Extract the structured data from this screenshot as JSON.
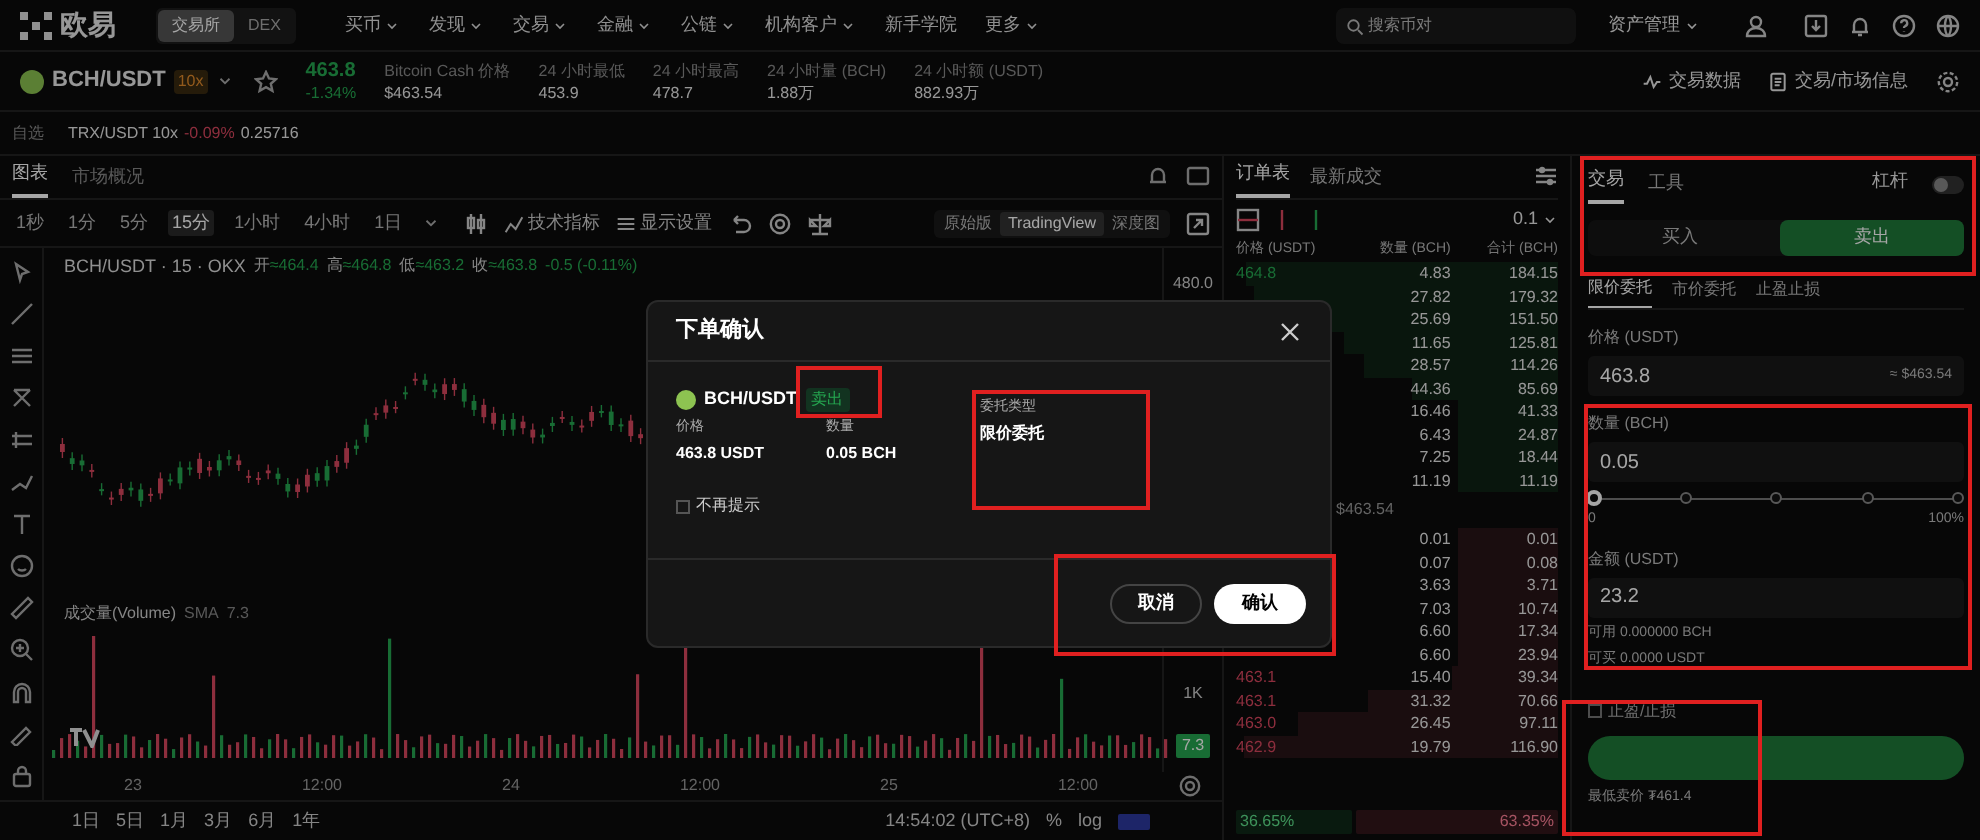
{
  "top_nav": {
    "logo": "欧易",
    "modes": [
      {
        "label": "交易所",
        "selected": true
      },
      {
        "label": "DEX",
        "selected": false
      }
    ],
    "menu": [
      {
        "label": "买币",
        "dropdown": true
      },
      {
        "label": "发现",
        "dropdown": true
      },
      {
        "label": "交易",
        "dropdown": true
      },
      {
        "label": "金融",
        "dropdown": true
      },
      {
        "label": "公链",
        "dropdown": true
      },
      {
        "label": "机构客户",
        "dropdown": true
      },
      {
        "label": "新手学院",
        "dropdown": false
      },
      {
        "label": "更多",
        "dropdown": true
      }
    ],
    "search": {
      "placeholder": "搜索币对"
    },
    "assets": "资产管理"
  },
  "ticker": {
    "pair": "BCH/USDT",
    "leverage": "10x",
    "price": "463.8",
    "change": "-1.34%",
    "stats": [
      {
        "label": "Bitcoin Cash 价格",
        "value": "$463.54"
      },
      {
        "label": "24 小时最低",
        "value": "453.9"
      },
      {
        "label": "24 小时最高",
        "value": "478.7"
      },
      {
        "label": "24 小时量 (BCH)",
        "value": "1.88万"
      },
      {
        "label": "24 小时额 (USDT)",
        "value": "882.93万"
      }
    ],
    "links": [
      "交易数据",
      "交易/市场信息"
    ]
  },
  "favorites": {
    "label": "自选",
    "items": [
      {
        "pair": "TRX/USDT 10x",
        "change": "-0.09%",
        "price": "0.25716"
      }
    ]
  },
  "chart_panel": {
    "tabs": [
      {
        "label": "图表",
        "selected": true
      },
      {
        "label": "市场概况",
        "selected": false
      }
    ],
    "intervals": [
      {
        "label": "1秒",
        "selected": false
      },
      {
        "label": "1分",
        "selected": false
      },
      {
        "label": "5分",
        "selected": false
      },
      {
        "label": "15分",
        "selected": true
      },
      {
        "label": "1小时",
        "selected": false
      },
      {
        "label": "4小时",
        "selected": false
      },
      {
        "label": "1日",
        "selected": false
      }
    ],
    "tools": [
      "技术指标",
      "显示设置"
    ],
    "views": [
      {
        "label": "原始版",
        "selected": false
      },
      {
        "label": "TradingView",
        "selected": true
      },
      {
        "label": "深度图",
        "selected": false
      }
    ],
    "legend": {
      "title": "BCH/USDT · 15 · OKX",
      "ohlc": [
        {
          "label": "开",
          "value": "≈464.4"
        },
        {
          "label": "高",
          "value": "≈464.8"
        },
        {
          "label": "低",
          "value": "≈463.2"
        },
        {
          "label": "收",
          "value": "≈463.8"
        }
      ],
      "change": "-0.5 (-0.11%)"
    },
    "price_axis": [
      "480.0"
    ],
    "volume_label": "成交量(Volume)",
    "volume_sma": "SMA",
    "volume_value": "7.3",
    "volume_axis": "1K",
    "volume_badge": "7.3",
    "time_axis": [
      "23",
      "12:00",
      "24",
      "12:00",
      "25",
      "12:00"
    ],
    "ranges": [
      "1日",
      "5日",
      "1月",
      "3月",
      "6月",
      "1年"
    ],
    "clock": "14:54:02 (UTC+8)",
    "scale_options": [
      "%",
      "log"
    ]
  },
  "order_book": {
    "tabs": [
      {
        "label": "订单表",
        "selected": true
      },
      {
        "label": "最新成交",
        "selected": false
      }
    ],
    "precision": "0.1",
    "columns": [
      "价格 (USDT)",
      "数量 (BCH)",
      "合计 (BCH)"
    ],
    "asks": [
      {
        "price": "464.8",
        "amount": "4.83",
        "total": "184.15"
      },
      {
        "amount": "27.82",
        "total": "179.32"
      },
      {
        "amount": "25.69",
        "total": "151.50"
      },
      {
        "amount": "11.65",
        "total": "125.81"
      },
      {
        "amount": "28.57",
        "total": "114.26"
      },
      {
        "amount": "44.36",
        "total": "85.69"
      },
      {
        "amount": "16.46",
        "total": "41.33"
      },
      {
        "amount": "6.43",
        "total": "24.87"
      },
      {
        "amount": "7.25",
        "total": "18.44"
      },
      {
        "amount": "11.19",
        "total": "11.19"
      }
    ],
    "mid_reference": "$463.54",
    "bids": [
      {
        "amount": "0.01",
        "total": "0.01"
      },
      {
        "amount": "0.07",
        "total": "0.08"
      },
      {
        "amount": "3.63",
        "total": "3.71"
      },
      {
        "amount": "7.03",
        "total": "10.74"
      },
      {
        "amount": "6.60",
        "total": "17.34"
      },
      {
        "amount": "6.60",
        "total": "23.94"
      },
      {
        "price": "463.1",
        "amount": "15.40",
        "total": "39.34"
      },
      {
        "price": "463.1",
        "amount": "31.32",
        "total": "70.66"
      },
      {
        "price": "463.0",
        "amount": "26.45",
        "total": "97.11"
      },
      {
        "price": "462.9",
        "amount": "19.79",
        "total": "116.90"
      }
    ],
    "buy_share": "36.65%",
    "sell_share": "63.35%"
  },
  "trade_panel": {
    "tabs": [
      {
        "label": "交易",
        "selected": true
      },
      {
        "label": "工具",
        "selected": false
      }
    ],
    "leverage": {
      "label": "杠杆",
      "on": false
    },
    "sides": [
      {
        "label": "买入",
        "selected": false
      },
      {
        "label": "卖出",
        "selected": true
      }
    ],
    "order_types": [
      {
        "label": "限价委托",
        "selected": true
      },
      {
        "label": "市价委托",
        "selected": false
      },
      {
        "label": "止盈止损",
        "selected": false
      }
    ],
    "price": {
      "label": "价格 (USDT)",
      "value": "463.8",
      "hint": "≈ $463.54"
    },
    "amount": {
      "label": "数量 (BCH)",
      "value": "0.05"
    },
    "slider": {
      "level": 0,
      "min_label": "0",
      "max_label": "100%"
    },
    "total": {
      "label": "金额 (USDT)",
      "value": "23.2"
    },
    "available": [
      "可用 0.000000 BCH",
      "可买 0.0000 USDT"
    ],
    "tp_sl": {
      "label": "止盈/止损",
      "checked": false
    },
    "lowest_sell": "最低卖价 ₮461.4"
  },
  "dialog": {
    "title": "下单确认",
    "pair": "BCH/USDT",
    "side": "卖出",
    "fields": [
      {
        "label": "价格",
        "value": "463.8 USDT"
      },
      {
        "label": "数量",
        "value": "0.05 BCH"
      },
      {
        "label": "委托类型",
        "value": "限价委托"
      }
    ],
    "dont_show": {
      "label": "不再提示",
      "checked": false
    },
    "buttons": [
      {
        "label": "取消",
        "kind": "secondary"
      },
      {
        "label": "确认",
        "kind": "primary"
      }
    ]
  }
}
